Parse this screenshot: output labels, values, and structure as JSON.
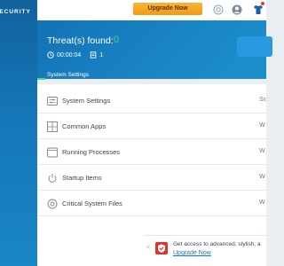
{
  "app": {
    "brand_text": "SECURITY"
  },
  "topbar": {
    "upgrade_label": "Upgrade Now",
    "icons": [
      "support-icon",
      "user-icon",
      "shirt-icon"
    ]
  },
  "scan": {
    "threats_label": "Threat(s) found:",
    "threats_count": "0",
    "elapsed": "00:00:04",
    "items_scanned": "1",
    "current_tab": "System Settings"
  },
  "list": {
    "items": [
      {
        "label": "System Settings",
        "status": "Sc",
        "icon": "sliders-icon"
      },
      {
        "label": "Common Apps",
        "status": "W",
        "icon": "grid-icon"
      },
      {
        "label": "Running Processes",
        "status": "W",
        "icon": "window-icon"
      },
      {
        "label": "Startup Items",
        "status": "W",
        "icon": "power-icon"
      },
      {
        "label": "Critical System Files",
        "status": "W",
        "icon": "target-icon"
      }
    ]
  },
  "promo": {
    "text": "Get access to advanced, stylish, a",
    "link": "Upgrade Now"
  },
  "colors": {
    "accent_blue": "#1a86c6",
    "threat_green": "#40d48a",
    "upgrade_orange": "#f19a11",
    "promo_red": "#e0332d"
  }
}
